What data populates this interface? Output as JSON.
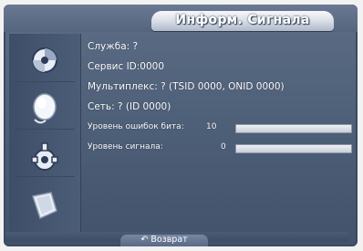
{
  "title": "Информ. Сигнала",
  "rows": {
    "service": "Служба: ?",
    "service_id": "Сервис ID:0000",
    "multiplex": "Мультиплекс: ? (TSID 0000, ONID 0000)",
    "network": "Сеть: ? (ID 0000)",
    "ber_label": "Уровень ошибок бита:",
    "ber_value": "10",
    "signal_label": "Уровень сигнала:",
    "signal_value": "0"
  },
  "levels": {
    "ber_fraction": 0,
    "signal_fraction": 0
  },
  "footer": {
    "return_label": "Возврат"
  },
  "icons": [
    "picture-icon",
    "sound-icon",
    "setup-icon",
    "input-icon"
  ],
  "colors": {
    "panel": "#4f6079",
    "bar": "#dfe3ea",
    "text": "#ffffff"
  }
}
